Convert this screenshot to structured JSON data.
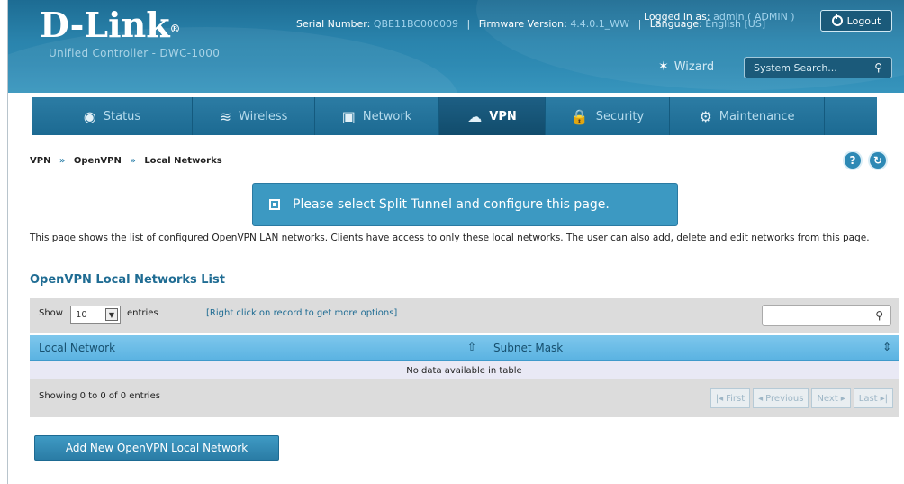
{
  "header": {
    "logo": "D-Link",
    "logo_reg": "®",
    "product": "Unified Controller - DWC-1000",
    "logged_in_label": "Logged in as:",
    "logged_in_value": "admin ( ADMIN )",
    "logout": "Logout",
    "serial_label": "Serial Number:",
    "serial_value": "QBE11BC000009",
    "firmware_label": "Firmware Version:",
    "firmware_value": "4.4.0.1_WW",
    "language_label": "Language:",
    "language_value": "English [US]",
    "wizard": "Wizard",
    "search_placeholder": "System Search..."
  },
  "nav": {
    "items": [
      {
        "label": "Status",
        "icon": "dashboard-icon",
        "glyph": "◉"
      },
      {
        "label": "Wireless",
        "icon": "wifi-icon",
        "glyph": "≋"
      },
      {
        "label": "Network",
        "icon": "monitor-icon",
        "glyph": "▣"
      },
      {
        "label": "VPN",
        "icon": "cloud-lock-icon",
        "glyph": "☁"
      },
      {
        "label": "Security",
        "icon": "lock-icon",
        "glyph": "🔒"
      },
      {
        "label": "Maintenance",
        "icon": "gears-icon",
        "glyph": "⚙"
      }
    ],
    "active": "VPN"
  },
  "breadcrumb": {
    "items": [
      "VPN",
      "OpenVPN",
      "Local Networks"
    ],
    "sep": "»"
  },
  "notice": "Please select Split Tunnel and configure this page.",
  "description": "This page shows the list of configured OpenVPN LAN networks. Clients have access to only these local networks. The user can also add, delete and edit networks from this page.",
  "section_title": "OpenVPN Local Networks List",
  "table": {
    "show_label": "Show",
    "show_value": "10",
    "entries_label": "entries",
    "hint": "[Right click on record to get more options]",
    "columns": [
      "Local Network",
      "Subnet Mask"
    ],
    "empty": "No data available in table",
    "showing": "Showing 0 to 0 of 0 entries",
    "pager": {
      "first": "First",
      "previous": "Previous",
      "next": "Next",
      "last": "Last"
    }
  },
  "add_button": "Add New OpenVPN Local Network",
  "colors": {
    "accent": "#2a84ad",
    "nav": "#1c6a92",
    "header_row": "#5bb3e2"
  }
}
